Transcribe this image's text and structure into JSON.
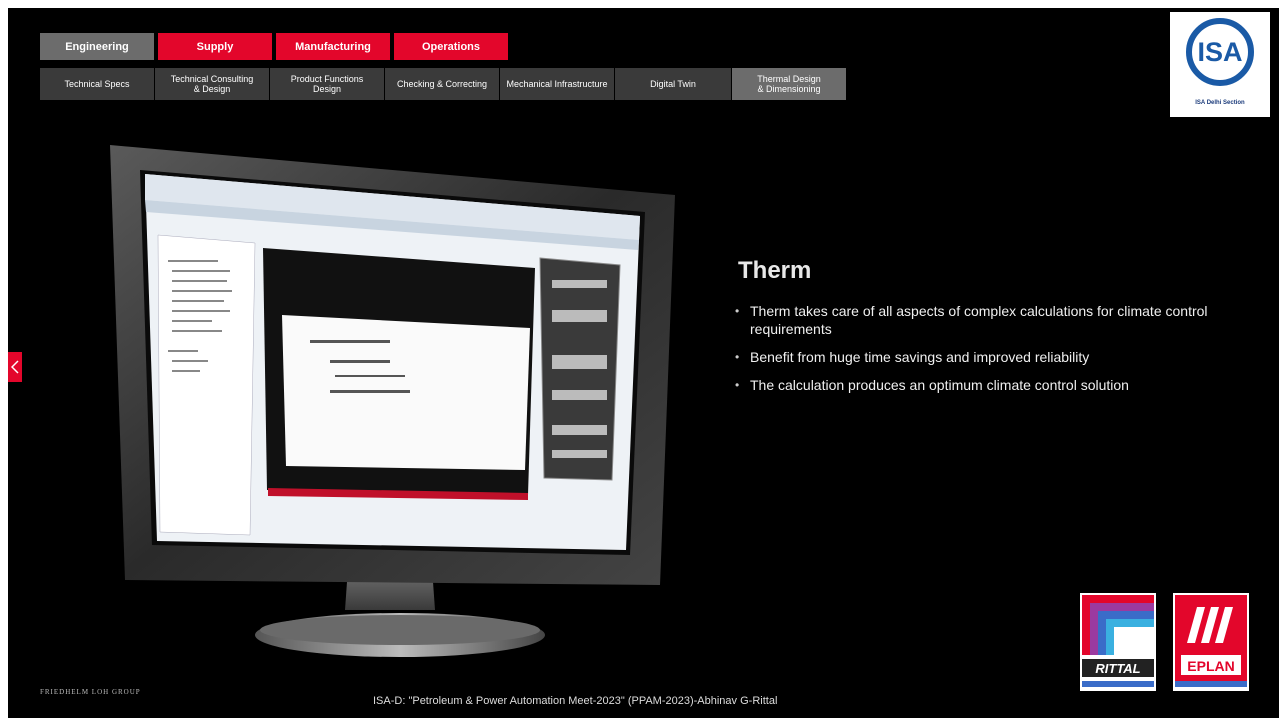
{
  "nav": {
    "main_tabs": [
      {
        "label": "Engineering",
        "color": "#6c6c6c"
      },
      {
        "label": "Supply",
        "color": "#e3062b"
      },
      {
        "label": "Manufacturing",
        "color": "#e3062b"
      },
      {
        "label": "Operations",
        "color": "#e3062b"
      }
    ],
    "sub_tabs": [
      {
        "label": "Technical Specs"
      },
      {
        "label": "Technical Consulting\n& Design"
      },
      {
        "label": "Product Functions\nDesign"
      },
      {
        "label": "Checking & Correcting"
      },
      {
        "label": "Mechanical Infrastructure"
      },
      {
        "label": "Digital Twin"
      },
      {
        "label": "Thermal Design\n& Dimensioning",
        "active": true
      }
    ]
  },
  "logos": {
    "isa_text": "ISA",
    "isa_tm": "TM",
    "isa_subtitle": "ISA Delhi Section",
    "rittal_text": "RITTAL",
    "eplan_text": "EPLAN"
  },
  "slide": {
    "title": "Therm",
    "bullets": [
      "Therm takes care of all aspects of complex calculations for climate control requirements",
      "Benefit from huge time savings and improved reliability",
      "The calculation produces an optimum climate control solution"
    ]
  },
  "footer": {
    "left": "FRIEDHELM LOH GROUP",
    "center": "ISA-D: \"Petroleum & Power Automation Meet-2023\" (PPAM-2023)-Abhinav G-Rittal"
  },
  "icons": {
    "prev": "chevron-left-icon"
  }
}
